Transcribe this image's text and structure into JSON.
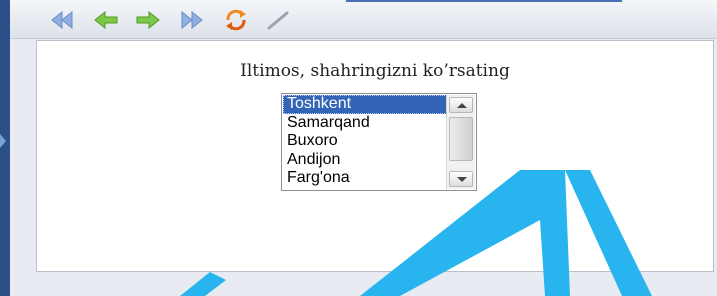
{
  "toolbar": {
    "buttons": [
      {
        "name": "first",
        "icon": "rewind-icon"
      },
      {
        "name": "back",
        "icon": "arrow-left-icon"
      },
      {
        "name": "forward",
        "icon": "arrow-right-icon"
      },
      {
        "name": "last",
        "icon": "fast-forward-icon"
      },
      {
        "name": "refresh",
        "icon": "refresh-icon"
      },
      {
        "name": "edit",
        "icon": "pencil-icon"
      }
    ]
  },
  "prompt": "Iltimos, shahringizni ko’rsating",
  "listbox": {
    "items": [
      "Toshkent",
      "Samarqand",
      "Buxoro",
      "Andijon",
      "Farg'ona"
    ],
    "selected_index": 0
  },
  "colors": {
    "selection": "#3264b8",
    "watermark": "#28b4ee",
    "nav_arrow_green": "#5cbf2a",
    "nav_arrow_blue": "#5a8fd6"
  }
}
